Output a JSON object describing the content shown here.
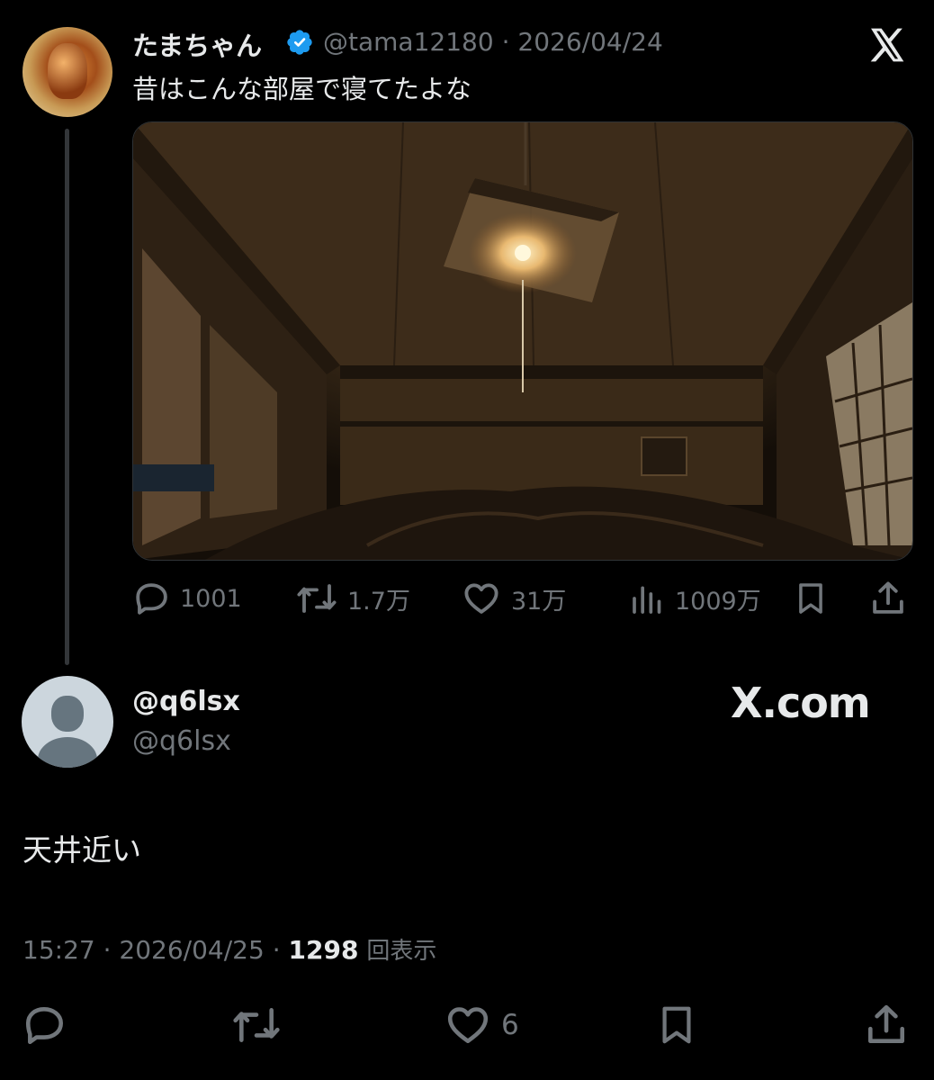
{
  "quoted_tweet": {
    "display_name": "たまちゃん",
    "handle": "@tama12180",
    "separator": "·",
    "date": "2026/04/24",
    "text": "昔はこんな部屋で寝てたよな",
    "stats": {
      "replies": "1001",
      "retweets": "1.7万",
      "likes": "31万",
      "views": "1009万"
    }
  },
  "reply": {
    "display_name": "@q6lsx",
    "handle": "@q6lsx",
    "brand": "X.com",
    "text": "天井近い",
    "time": "15:27",
    "date": "2026/04/25",
    "views_count": "1298",
    "views_label": "回表示",
    "likes": "6"
  },
  "icons": {
    "verified": "verified-badge-icon",
    "x_logo": "x-logo-icon",
    "reply": "reply-icon",
    "retweet": "retweet-icon",
    "like": "heart-icon",
    "views": "views-chart-icon",
    "bookmark": "bookmark-icon",
    "share": "share-icon"
  },
  "colors": {
    "background": "#000000",
    "text": "#e7e9ea",
    "muted": "#71767b",
    "verified": "#1d9bf0",
    "thread_line": "#333639"
  }
}
